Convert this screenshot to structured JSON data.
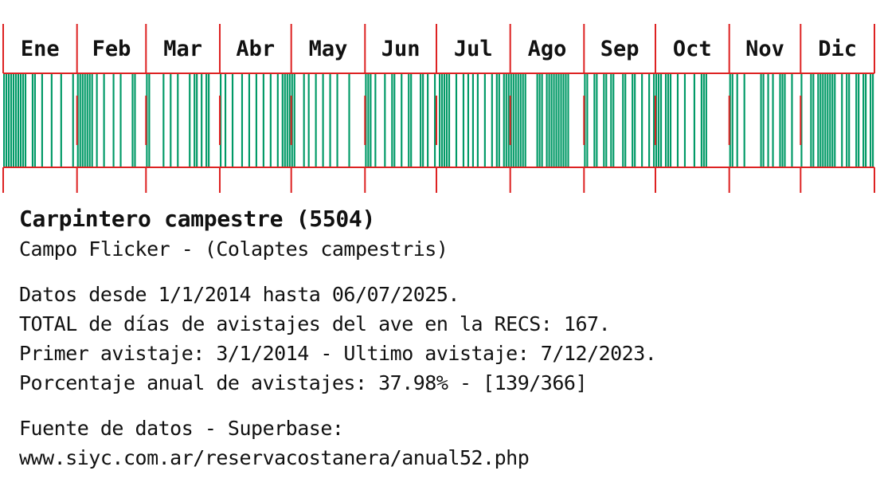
{
  "chart_data": {
    "type": "bar",
    "months": [
      "Ene",
      "Feb",
      "Mar",
      "Abr",
      "May",
      "Jun",
      "Jul",
      "Ago",
      "Sep",
      "Oct",
      "Nov",
      "Dic"
    ],
    "days_in_month": [
      31,
      29,
      31,
      30,
      31,
      30,
      31,
      31,
      30,
      31,
      30,
      31
    ],
    "sighting_days": [
      [
        1,
        2,
        3,
        4,
        5,
        6,
        7,
        8,
        9,
        10,
        13,
        14,
        17,
        21,
        25,
        30
      ],
      [
        1,
        2,
        3,
        4,
        5,
        6,
        7,
        9,
        12,
        16,
        19,
        24,
        25
      ],
      [
        1,
        2,
        8,
        11,
        14,
        19,
        21,
        22,
        24,
        26,
        27
      ],
      [
        1,
        3,
        6,
        10,
        13,
        16,
        19,
        22,
        25,
        27,
        28,
        29,
        30
      ],
      [
        1,
        2,
        6,
        8,
        11,
        14,
        17,
        20,
        25
      ],
      [
        1,
        2,
        3,
        5,
        9,
        12,
        13,
        16,
        19,
        20,
        24,
        25,
        27,
        30
      ],
      [
        2,
        3,
        4,
        5,
        6,
        9,
        12,
        14,
        16,
        18,
        21,
        24,
        26,
        27,
        29,
        30,
        31
      ],
      [
        1,
        2,
        3,
        4,
        5,
        6,
        7,
        12,
        13,
        14,
        16,
        17,
        18,
        19,
        20,
        21,
        22,
        23,
        24,
        25
      ],
      [
        1,
        2,
        5,
        6,
        9,
        10,
        12,
        13,
        17,
        18,
        21,
        22,
        25,
        28,
        30
      ],
      [
        1,
        2,
        3,
        5,
        6,
        7,
        10,
        13,
        17,
        20,
        21,
        22
      ],
      [
        1,
        2,
        4,
        7,
        14,
        15,
        17,
        19,
        22,
        23,
        24,
        27
      ],
      [
        1,
        5,
        6,
        8,
        9,
        10,
        11,
        12,
        13,
        14,
        15,
        18,
        20,
        21,
        24,
        25,
        27,
        28,
        30,
        31
      ]
    ],
    "total_days": 167,
    "colors": {
      "sighting": "#009966",
      "grid": "#dd2222",
      "background": "#ffffff"
    }
  },
  "info": {
    "title": "Carpintero campestre (5504)",
    "subtitle": "Campo Flicker - (Colaptes campestris)",
    "lines": [
      "Datos desde 1/1/2014 hasta 06/07/2025.",
      "TOTAL de días de avistajes del ave en la RECS: 167.",
      "Primer avistaje: 3/1/2014 - Ultimo avistaje: 7/12/2023.",
      "Porcentaje anual de avistajes: 37.98% - [139/366]"
    ],
    "source_label": "Fuente de datos - Superbase:",
    "source_url": "www.siyc.com.ar/reservacostanera/anual52.php"
  }
}
